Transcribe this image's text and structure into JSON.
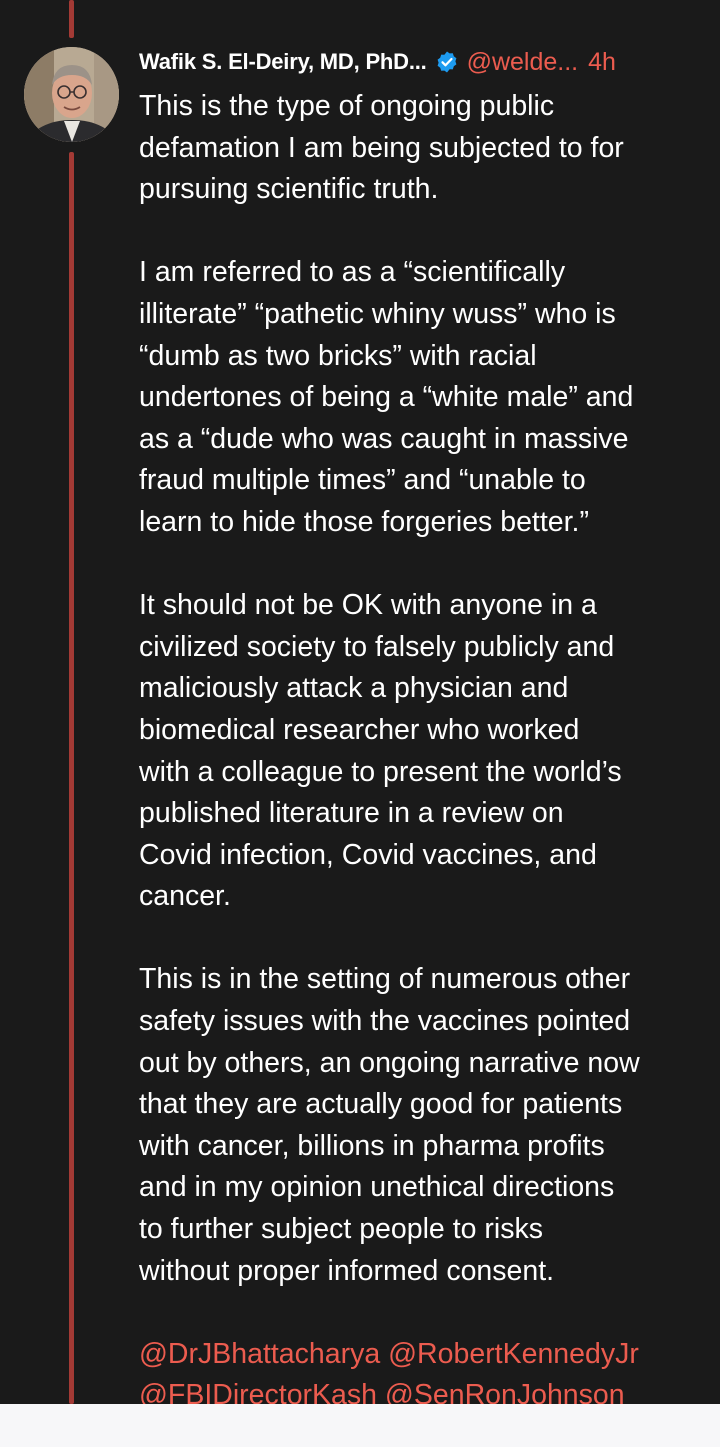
{
  "post": {
    "author_name": "Wafik S. El-Deiry, MD, PhD...",
    "handle": "@welde...",
    "time": "4h",
    "colors": {
      "background": "#1a1a1a",
      "thread_line": "#a33a35",
      "accent": "#ec5c4f",
      "verified": "#1d9bf0",
      "bottom_bar": "#f7f7f9"
    },
    "lines_p1": [
      "This is the type of ongoing public",
      "defamation I am being subjected to for",
      "pursuing scientific truth."
    ],
    "lines_p2": [
      "I am referred to as a “scientifically",
      "illiterate” “pathetic whiny wuss” who is",
      "“dumb as two bricks” with racial",
      "undertones of being a “white male” and",
      "as a “dude who was caught in massive",
      "fraud multiple times” and “unable to",
      "learn to hide those forgeries better.”"
    ],
    "lines_p3": [
      "It should not be OK with anyone in a",
      "civilized society to falsely publicly and",
      "maliciously attack a physician and",
      "biomedical researcher who worked",
      "with a colleague to present the world’s",
      "published literature in a review on",
      "Covid infection, Covid vaccines, and",
      "cancer."
    ],
    "lines_p4": [
      "This is in the setting of numerous other",
      "safety issues with the vaccines pointed",
      "out by others, an ongoing narrative now",
      "that they are actually good for patients",
      "with cancer, billions in pharma profits",
      "and in my opinion unethical directions",
      "to further subject people to risks",
      "without proper informed consent."
    ],
    "mentions_line1": [
      "@DrJBhattacharya",
      "@RobertKennedyJr"
    ],
    "mentions_line2": [
      "@FBIDirectorKash",
      "@SenRonJohnson"
    ]
  }
}
